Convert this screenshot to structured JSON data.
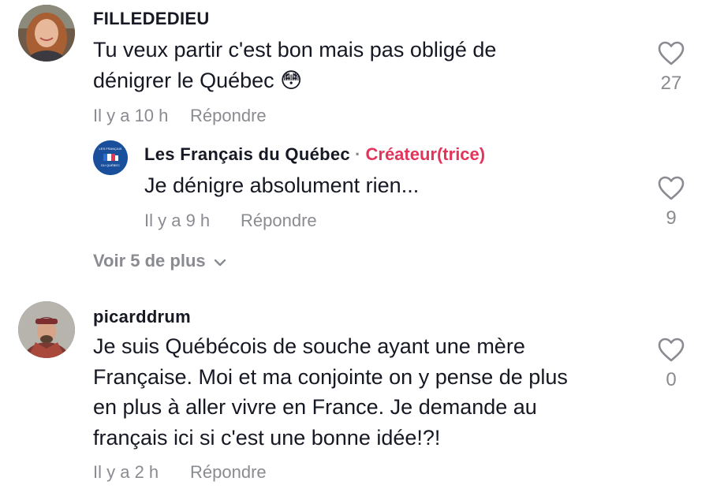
{
  "comments": [
    {
      "username": "FILLEDEDIEU",
      "text_line1": "Tu veux partir c'est bon mais pas obligé de",
      "text_line2": "dénigrer le Québec 😳",
      "time": "Il y a 10 h",
      "reply_label": "Répondre",
      "likes": "27"
    },
    {
      "username": "picarddrum",
      "text_line1": "Je suis Québécois de souche ayant une mère",
      "text_line2": "Française. Moi et ma conjointe on y pense de plus",
      "text_line3": "en plus à aller vivre en France. Je demande au",
      "text_line4": "français ici si c'est une bonne idée!?!",
      "time": "Il y a 2 h",
      "reply_label": "Répondre",
      "likes": "0"
    }
  ],
  "reply": {
    "username": "Les Français du Québec",
    "separator": "·",
    "badge": "Créateur(trice)",
    "text": "Je dénigre absolument rien...",
    "time": "Il y a 9 h",
    "reply_label": "Répondre",
    "likes": "9",
    "avatar_label_top": "LES FRANÇAIS",
    "avatar_label_bottom": "DU QUÉBEC"
  },
  "view_more": {
    "label": "Voir 5 de plus"
  },
  "colors": {
    "creator_badge": "#e3345c",
    "muted": "#8a8b91",
    "text": "#161823",
    "creator_avatar_bg": "#1a4f9c"
  },
  "icons": {
    "like": "heart-outline-icon",
    "expand": "chevron-down-icon"
  }
}
